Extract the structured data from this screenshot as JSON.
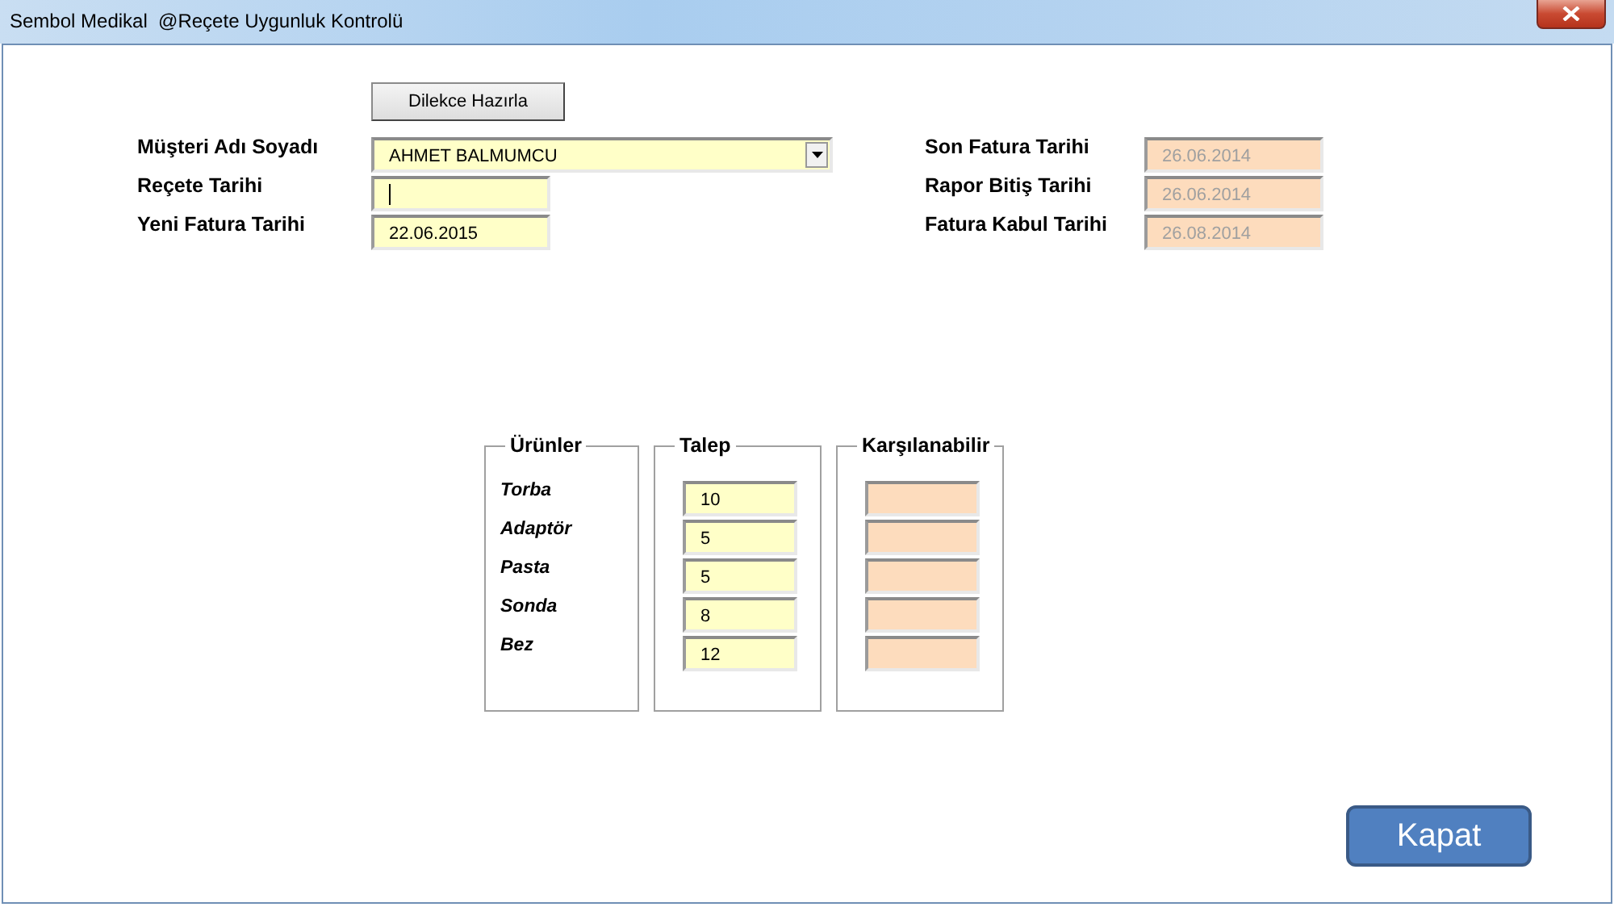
{
  "window": {
    "title": "Sembol Medikal  @Reçete Uygunluk Kontrolü"
  },
  "petition_button": "Dilekce Hazırla",
  "left_fields": [
    {
      "label": "Müşteri Adı Soyadı",
      "kind": "dropdown",
      "value": "AHMET BALMUMCU",
      "disabled": false,
      "focused": false
    },
    {
      "label": "Reçete Tarihi",
      "kind": "text",
      "disabled": false,
      "focused": true
    },
    {
      "label": "Yeni Fatura Tarihi",
      "kind": "text",
      "value": "22.06.2015",
      "disabled": false,
      "focused": false
    }
  ],
  "right_fields": [
    {
      "label": "Son Fatura Tarihi",
      "value": "26.06.2014",
      "disabled": true
    },
    {
      "label": "Rapor Bitiş Tarihi",
      "value": "26.06.2014",
      "disabled": true
    },
    {
      "label": "Fatura Kabul Tarihi",
      "value": "26.08.2014",
      "disabled": true
    }
  ],
  "group_titles": {
    "products": "Ürünler",
    "request": "Talep",
    "available": "Karşılanabilir"
  },
  "products": [
    {
      "name": "Torba",
      "request": {
        "value": "10",
        "disabled": false
      },
      "available": {
        "disabled": true
      }
    },
    {
      "name": "Adaptör",
      "request": {
        "value": "5",
        "disabled": false
      },
      "available": {
        "disabled": true
      }
    },
    {
      "name": "Pasta",
      "request": {
        "value": "5",
        "disabled": false
      },
      "available": {
        "disabled": true
      }
    },
    {
      "name": "Sonda",
      "request": {
        "value": "8",
        "disabled": false
      },
      "available": {
        "disabled": true
      }
    },
    {
      "name": "Bez",
      "request": {
        "value": "12",
        "disabled": false
      },
      "available": {
        "disabled": true
      }
    }
  ],
  "close_button": "Kapat"
}
